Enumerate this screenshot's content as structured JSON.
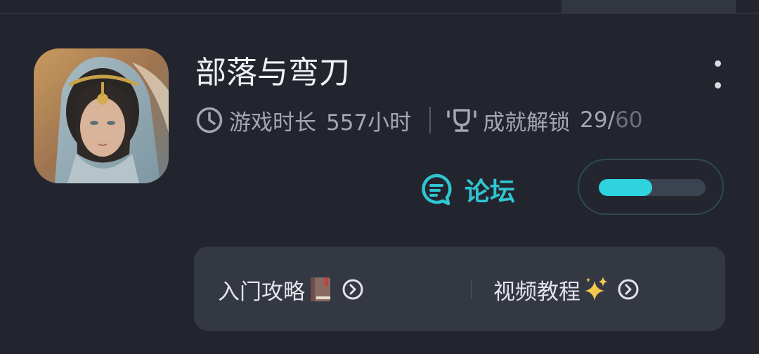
{
  "game": {
    "title": "部落与弯刀",
    "cover_alt": "game-cover-portrait"
  },
  "stats": {
    "playtime_label": "游戏时长",
    "playtime_value": "557小时",
    "achievement_label": "成就解锁",
    "achievement_unlocked": "29",
    "achievement_separator": "/",
    "achievement_total": "60"
  },
  "forum": {
    "label": "论坛"
  },
  "progress": {
    "fraction": 0.5
  },
  "guides": {
    "beginner_label": "入门攻略",
    "beginner_emoji": "book-icon",
    "video_label": "视频教程",
    "video_emoji": "sparkles-icon"
  },
  "colors": {
    "background": "#23252e",
    "accent": "#2fc6d3",
    "card": "#343843",
    "muted_text": "#a3a7b2"
  }
}
